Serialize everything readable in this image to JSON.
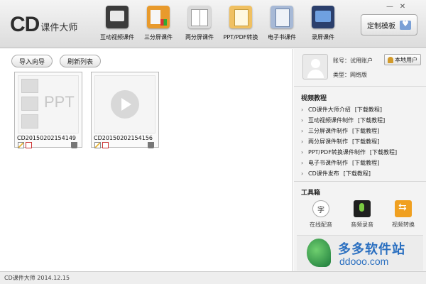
{
  "app": {
    "logo_cd": "CD",
    "logo_text": "课件大师"
  },
  "window": {
    "minimize": "—",
    "close": "✕"
  },
  "toolbar": [
    {
      "label": "互动视频课件",
      "icon": "video-courseware-icon"
    },
    {
      "label": "三分屏课件",
      "icon": "three-split-screen-icon"
    },
    {
      "label": "两分屏课件",
      "icon": "two-split-screen-icon"
    },
    {
      "label": "PPT/PDF转换",
      "icon": "ppt-pdf-convert-icon"
    },
    {
      "label": "电子书课件",
      "icon": "ebook-icon"
    },
    {
      "label": "录屏课件",
      "icon": "screen-record-icon"
    }
  ],
  "custom_template": {
    "label": "定制模板",
    "icon": "template-icon"
  },
  "actions": {
    "import_label": "导入向导",
    "refresh_label": "刷新列表"
  },
  "courses": [
    {
      "name": "CD20150202154149",
      "type": "ppt",
      "thumb_text": "PPT"
    },
    {
      "name": "CD20150202154156",
      "type": "video"
    }
  ],
  "account": {
    "account_label": "账号：",
    "account_value": "试用账户",
    "type_label": "类型：",
    "type_value": "网络版",
    "local_user_label": "本地用户"
  },
  "tutorials": {
    "title": "视频教程",
    "items": [
      {
        "name": "CD课件大师介绍",
        "download": "[下载教程]"
      },
      {
        "name": "互动视频课件制作",
        "download": "[下载教程]"
      },
      {
        "name": "三分屏课件制作",
        "download": "[下载教程]"
      },
      {
        "name": "两分屏课件制作",
        "download": "[下载教程]"
      },
      {
        "name": "PPT/PDF转换课件制作",
        "download": "[下载教程]"
      },
      {
        "name": "电子书课件制作",
        "download": "[下载教程]"
      },
      {
        "name": "CD课件发布",
        "download": "[下载教程]"
      }
    ]
  },
  "toolbox": {
    "title": "工具箱",
    "items": [
      {
        "label": "在线配音",
        "icon": "online-dubbing-icon"
      },
      {
        "label": "音频录音",
        "icon": "audio-record-icon"
      },
      {
        "label": "视频转换",
        "icon": "video-convert-icon"
      }
    ]
  },
  "watermark": {
    "name": "多多软件站",
    "url": "ddooo.com"
  },
  "status": {
    "text": "CD课件大师 2014.12.15"
  }
}
